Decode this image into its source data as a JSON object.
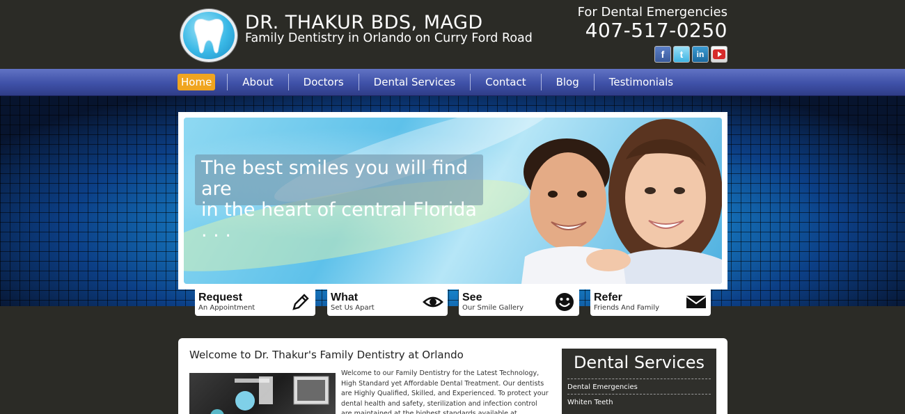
{
  "header": {
    "title": "DR. THAKUR BDS, MAGD",
    "subtitle": "Family Dentistry in Orlando on Curry Ford Road",
    "emergency_label": "For Dental Emergencies",
    "emergency_phone": "407-517-0250",
    "social": [
      {
        "icon": "facebook-icon",
        "glyph": "f"
      },
      {
        "icon": "twitter-icon",
        "glyph": "t"
      },
      {
        "icon": "linkedin-icon",
        "glyph": "in"
      },
      {
        "icon": "youtube-icon",
        "glyph": "▶"
      }
    ]
  },
  "nav": {
    "items": [
      "Home",
      "About",
      "Doctors",
      "Dental Services",
      "Contact",
      "Blog",
      "Testimonials"
    ],
    "active": "Home"
  },
  "hero": {
    "tagline_line1": "The best smiles you will find are",
    "tagline_line2": "in the heart of central Florida . . ."
  },
  "actions": [
    {
      "title": "Request",
      "sub": "An Appointment",
      "icon": "pencil-icon"
    },
    {
      "title": "What",
      "sub": "Set Us Apart",
      "icon": "eye-icon"
    },
    {
      "title": "See",
      "sub": "Our Smile Gallery",
      "icon": "smiley-icon"
    },
    {
      "title": "Refer",
      "sub": "Friends And Family",
      "icon": "envelope-icon"
    }
  ],
  "content": {
    "welcome_title": "Welcome to Dr. Thakur's Family Dentistry at Orlando",
    "welcome_text": "Welcome to our Family Dentistry for the Latest Technology, High Standard yet Affordable Dental Treatment. Our dentists are Highly Qualified, Skilled, and Experienced. To protect your dental health and safety, sterilization and infection control are maintained at the highest standards available at"
  },
  "sidebar": {
    "title": "Dental Services",
    "items": [
      "Dental Emergencies",
      "Whiten Teeth"
    ]
  },
  "colors": {
    "background": "#2b2b26",
    "nav_blue": "#3f51a8",
    "active_orange": "#f0a520",
    "sidebar_bg": "#2f2f2b"
  }
}
